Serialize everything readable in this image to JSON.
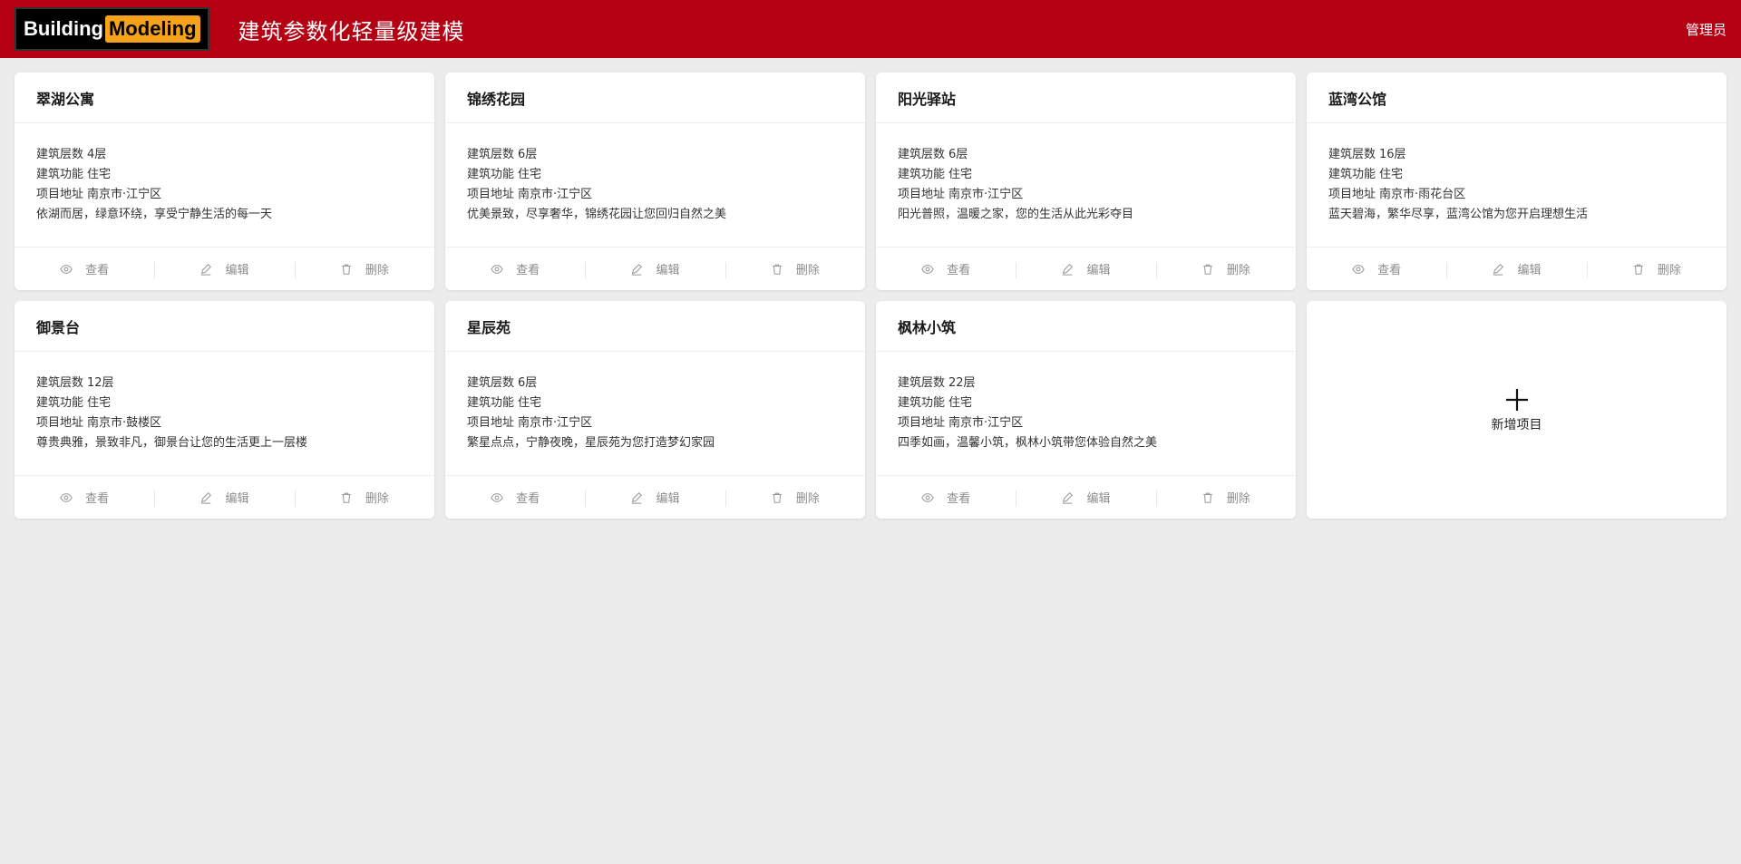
{
  "header": {
    "logo_part1": "Building",
    "logo_part2": "Modeling",
    "title": "建筑参数化轻量级建模",
    "user": "管理员",
    "brand_color": "#b50014",
    "logo_accent": "#f7a21b"
  },
  "labels": {
    "floors": "建筑层数",
    "function": "建筑功能",
    "address": "项目地址",
    "view": "查看",
    "edit": "编辑",
    "delete": "删除",
    "add_project": "新增项目"
  },
  "projects": [
    {
      "name": "翠湖公寓",
      "floors": "4层",
      "function": "住宅",
      "address": "南京市·江宁区",
      "desc": "依湖而居，绿意环绕，享受宁静生活的每一天"
    },
    {
      "name": "锦绣花园",
      "floors": "6层",
      "function": "住宅",
      "address": "南京市·江宁区",
      "desc": "优美景致，尽享奢华，锦绣花园让您回归自然之美"
    },
    {
      "name": "阳光驿站",
      "floors": "6层",
      "function": "住宅",
      "address": "南京市·江宁区",
      "desc": "阳光普照，温暖之家，您的生活从此光彩夺目"
    },
    {
      "name": "蓝湾公馆",
      "floors": "16层",
      "function": "住宅",
      "address": "南京市·雨花台区",
      "desc": "蓝天碧海，繁华尽享，蓝湾公馆为您开启理想生活"
    },
    {
      "name": "御景台",
      "floors": "12层",
      "function": "住宅",
      "address": "南京市·鼓楼区",
      "desc": "尊贵典雅，景致非凡，御景台让您的生活更上一层楼"
    },
    {
      "name": "星辰苑",
      "floors": "6层",
      "function": "住宅",
      "address": "南京市·江宁区",
      "desc": "繁星点点，宁静夜晚，星辰苑为您打造梦幻家园"
    },
    {
      "name": "枫林小筑",
      "floors": "22层",
      "function": "住宅",
      "address": "南京市·江宁区",
      "desc": "四季如画，温馨小筑，枫林小筑带您体验自然之美"
    }
  ],
  "icons": {
    "view": "eye-icon",
    "edit": "pencil-icon",
    "delete": "trash-icon",
    "add": "plus-icon"
  }
}
